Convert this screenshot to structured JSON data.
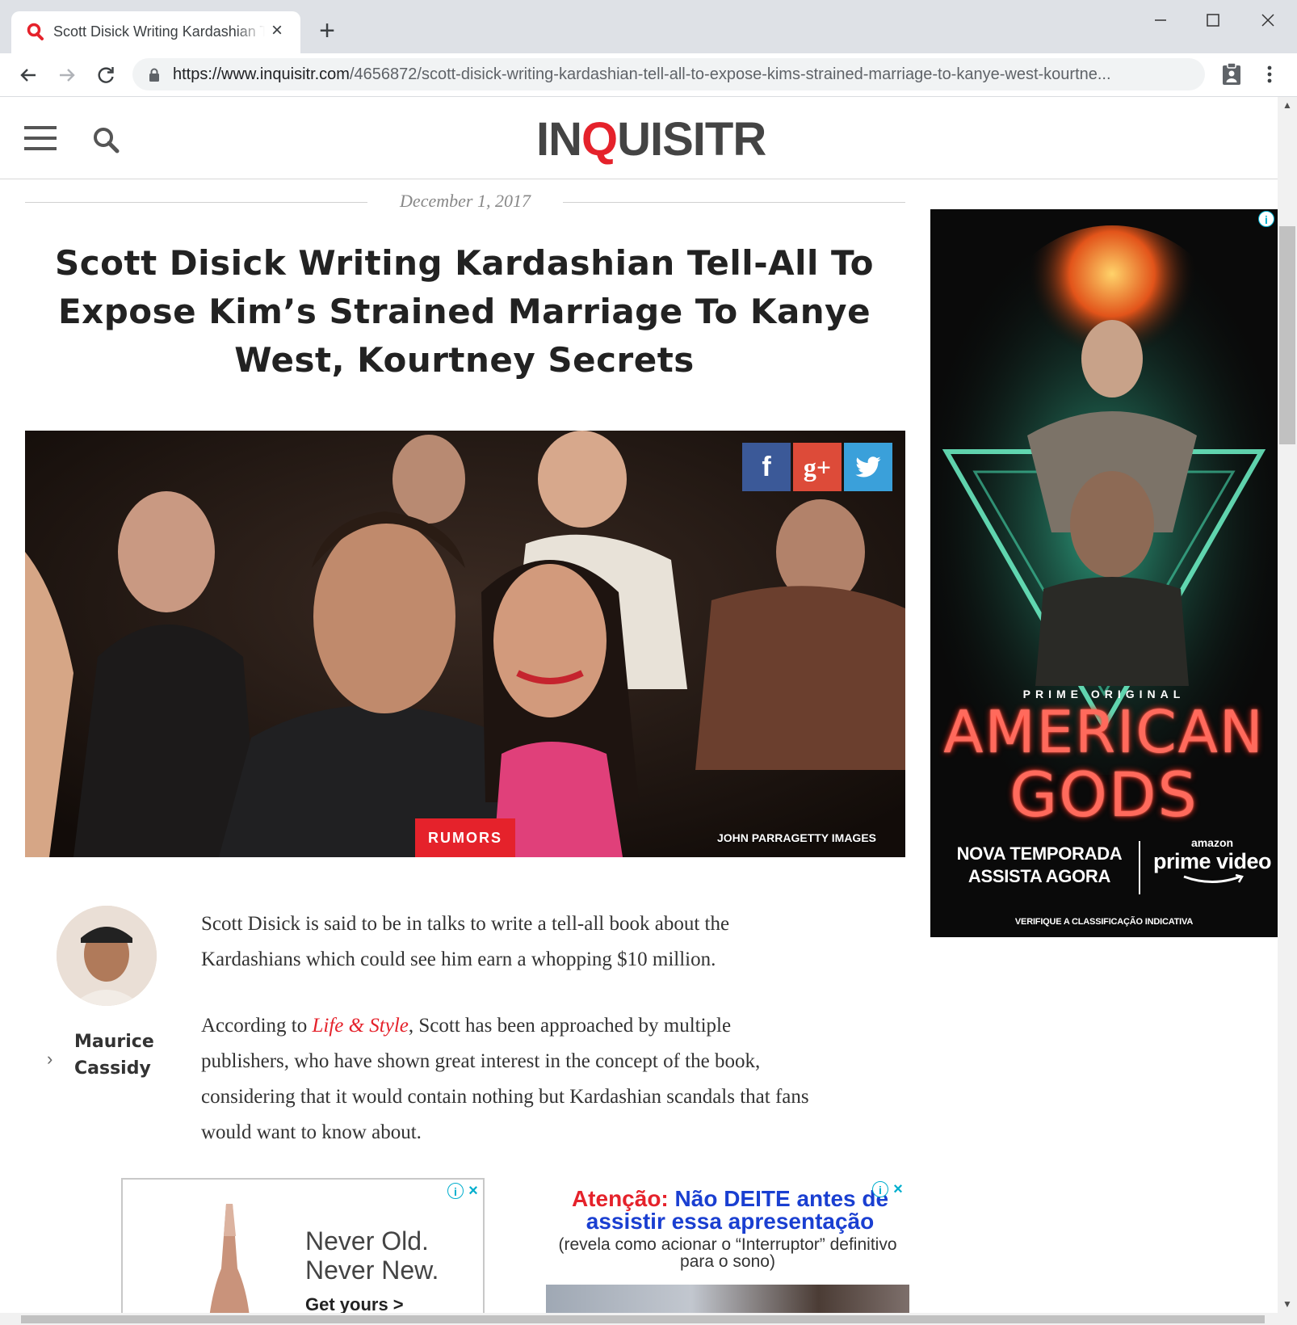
{
  "browser": {
    "tab_title": "Scott Disick Writing Kardashian Tell-All To Expose Kim's Strained Marriage",
    "url_host": "https://www.inquisitr.com",
    "url_path": "/4656872/scott-disick-writing-kardashian-tell-all-to-expose-kims-strained-marriage-to-kanye-west-kourtne..."
  },
  "site": {
    "logo_left": "IN",
    "logo_q": "Q",
    "logo_right": "UISITR",
    "accent_color": "#e5222b"
  },
  "article": {
    "date": "December 1, 2017",
    "headline": "Scott Disick Writing Kardashian Tell-All To Expose Kim’s Strained Marriage To Kanye West, Kourtney Secrets",
    "tag": "RUMORS",
    "photo_credit": "JOHN PARRAGETTY IMAGES",
    "share": {
      "facebook": "f",
      "google_plus": "g+"
    },
    "author": {
      "first": "Maurice",
      "last": "Cassidy"
    },
    "paragraph1": "Scott Disick is said to be in talks to write a tell-all book about the Kardashians which could see him earn a whopping $10 million.",
    "paragraph2_before": "According to ",
    "paragraph2_link": "Life & Style",
    "paragraph2_after": ", Scott has been approached by multiple publishers, who have shown great interest in the concept of the book, considering that it would contain nothing but Kardashian scandals that fans would want to know about."
  },
  "side_ad": {
    "subtitle": "PRIME ORIGINAL",
    "title_line1": "AMERICAN",
    "title_line2": "GODS",
    "left_line1": "NOVA TEMPORADA",
    "left_line2": "ASSISTA AGORA",
    "brand_small": "amazon",
    "brand_big": "prime video",
    "fine_print": "VERIFIQUE A CLASSIFICAÇÃO INDICATIVA"
  },
  "ad1": {
    "line1": "Never Old.",
    "line2": "Never New.",
    "cta": "Get yours >"
  },
  "ad2": {
    "attention": "Atenção:",
    "headline": " Não DEITE antes de assistir essa apresentação",
    "sub": "(revela como acionar o “Interruptor” definitivo para o sono)"
  }
}
